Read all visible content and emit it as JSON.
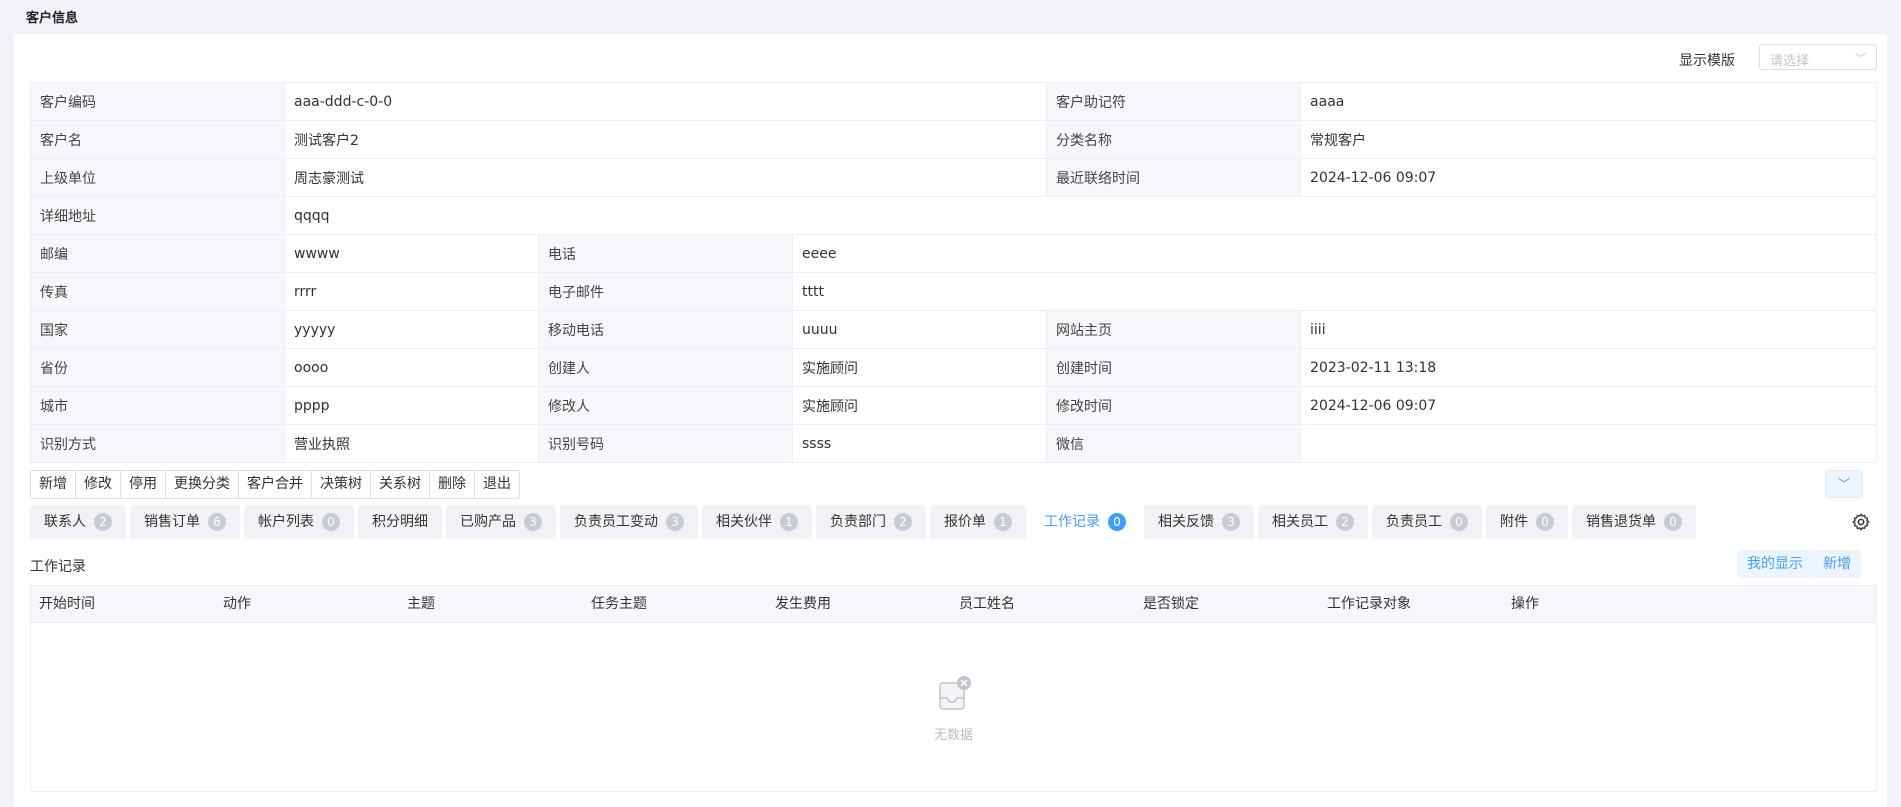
{
  "header": {
    "title": "客户信息"
  },
  "template": {
    "label": "显示模版",
    "placeholder": "请选择"
  },
  "info_rows": [
    [
      [
        "客户编码",
        "aaa-ddd-c-0-0",
        3
      ],
      [
        "客户助记符",
        "aaaa",
        1
      ]
    ],
    [
      [
        "客户名",
        "测试客户2",
        3
      ],
      [
        "分类名称",
        "常规客户",
        1
      ]
    ],
    [
      [
        "上级单位",
        "周志豪测试",
        3
      ],
      [
        "最近联络时间",
        "2024-12-06 09:07",
        1
      ]
    ],
    [
      [
        "详细地址",
        "qqqq",
        5
      ]
    ],
    [
      [
        "邮编",
        "wwww",
        1
      ],
      [
        "电话",
        "eeee",
        3
      ]
    ],
    [
      [
        "传真",
        "rrrr",
        1
      ],
      [
        "电子邮件",
        "tttt",
        3
      ]
    ],
    [
      [
        "国家",
        "yyyyy",
        1
      ],
      [
        "移动电话",
        "uuuu",
        1
      ],
      [
        "网站主页",
        "iiii",
        1
      ]
    ],
    [
      [
        "省份",
        "oooo",
        1
      ],
      [
        "创建人",
        "实施顾问",
        1
      ],
      [
        "创建时间",
        "2023-02-11 13:18",
        1
      ]
    ],
    [
      [
        "城市",
        "pppp",
        1
      ],
      [
        "修改人",
        "实施顾问",
        1
      ],
      [
        "修改时间",
        "2024-12-06 09:07",
        1
      ]
    ],
    [
      [
        "识别方式",
        "营业执照",
        1
      ],
      [
        "识别号码",
        "ssss",
        1
      ],
      [
        "微信",
        "",
        1
      ]
    ]
  ],
  "toolbar": [
    "新增",
    "修改",
    "停用",
    "更换分类",
    "客户合并",
    "决策树",
    "关系树",
    "删除",
    "退出"
  ],
  "tabs": [
    {
      "label": "联系人",
      "count": "2"
    },
    {
      "label": "销售订单",
      "count": "6"
    },
    {
      "label": "帐户列表",
      "count": "0"
    },
    {
      "label": "积分明细",
      "count": ""
    },
    {
      "label": "已购产品",
      "count": "3"
    },
    {
      "label": "负责员工变动",
      "count": "3"
    },
    {
      "label": "相关伙伴",
      "count": "1"
    },
    {
      "label": "负责部门",
      "count": "2"
    },
    {
      "label": "报价单",
      "count": "1"
    },
    {
      "label": "工作记录",
      "count": "0",
      "active": true
    },
    {
      "label": "相关反馈",
      "count": "3"
    },
    {
      "label": "相关员工",
      "count": "2"
    },
    {
      "label": "负责员工",
      "count": "0"
    },
    {
      "label": "附件",
      "count": "0"
    },
    {
      "label": "销售退货单",
      "count": "0"
    }
  ],
  "section": {
    "title": "工作记录",
    "my_display_label": "我的显示",
    "add_label": "新增",
    "columns": [
      "开始时间",
      "动作",
      "主题",
      "任务主题",
      "发生费用",
      "员工姓名",
      "是否锁定",
      "工作记录对象",
      "操作"
    ],
    "empty_text": "无数据"
  },
  "colors": {
    "accent": "#409eff",
    "badge": "#c8cbd0"
  }
}
